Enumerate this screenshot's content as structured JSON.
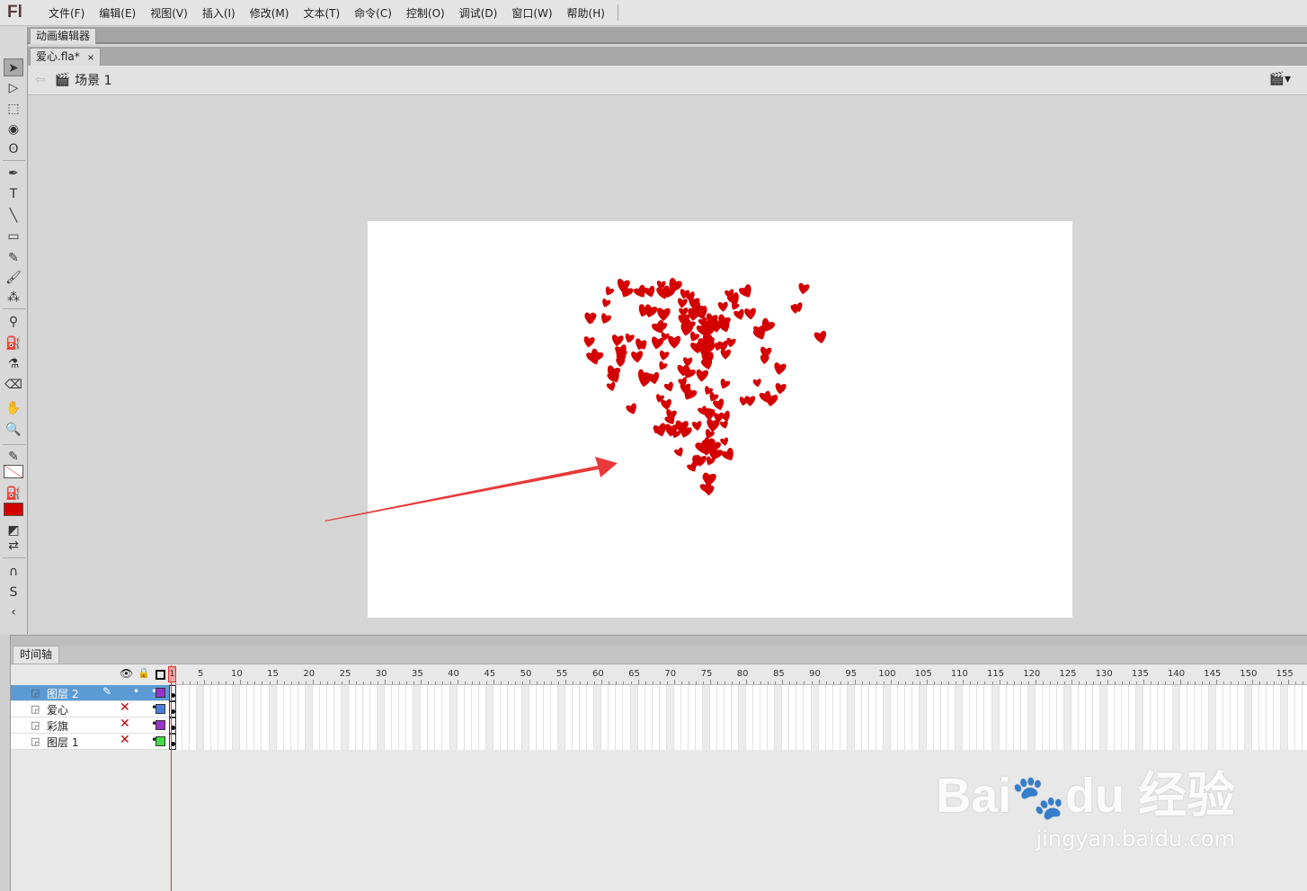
{
  "app": {
    "logo": "Fl"
  },
  "menu": [
    "文件(F)",
    "编辑(E)",
    "视图(V)",
    "插入(I)",
    "修改(M)",
    "文本(T)",
    "命令(C)",
    "控制(O)",
    "调试(D)",
    "窗口(W)",
    "帮助(H)"
  ],
  "panel_tab": "动画编辑器",
  "document_tab": {
    "name": "爱心.fla*",
    "close": "×"
  },
  "scene": {
    "label": "场景 1"
  },
  "tools": [
    "selection-icon",
    "subselection-icon",
    "free-transform-icon",
    "3d-rotation-icon",
    "lasso-icon",
    "pen-icon",
    "text-icon",
    "line-icon",
    "rectangle-icon",
    "pencil-icon",
    "brush-icon",
    "deco-icon",
    "bone-icon",
    "paint-bucket-icon",
    "eyedropper-icon",
    "eraser-icon",
    "hand-icon",
    "zoom-icon",
    "stroke-color-icon",
    "fill-color-icon",
    "black-white-icon",
    "swap-colors-icon",
    "snap-icon",
    "smooth-icon",
    "straighten-icon"
  ],
  "colors": {
    "stroke": "none",
    "fill": "#d40000",
    "heart": "#d40000",
    "arrow": "#e83a3a",
    "active_layer": "#5b9bd5"
  },
  "timeline": {
    "tab": "时间轴",
    "current_frame": "1",
    "frame_labels": [
      "5",
      "10",
      "15",
      "20",
      "25",
      "30",
      "35",
      "40",
      "45",
      "50",
      "55",
      "60",
      "65",
      "70",
      "75",
      "80",
      "85",
      "90",
      "95",
      "100",
      "105",
      "110",
      "115",
      "120",
      "125",
      "130",
      "135",
      "140",
      "145",
      "150",
      "155"
    ],
    "layers": [
      {
        "name": "图层 2",
        "active": true,
        "color": "#9933cc"
      },
      {
        "name": "爱心",
        "active": false,
        "color": "#4a7fe0"
      },
      {
        "name": "彩旗",
        "active": false,
        "color": "#9933cc"
      },
      {
        "name": "图层 1",
        "active": false,
        "color": "#44dd44"
      }
    ]
  },
  "watermark": {
    "brand": "Bai du 经验",
    "url": "jingyan.baidu.com"
  }
}
